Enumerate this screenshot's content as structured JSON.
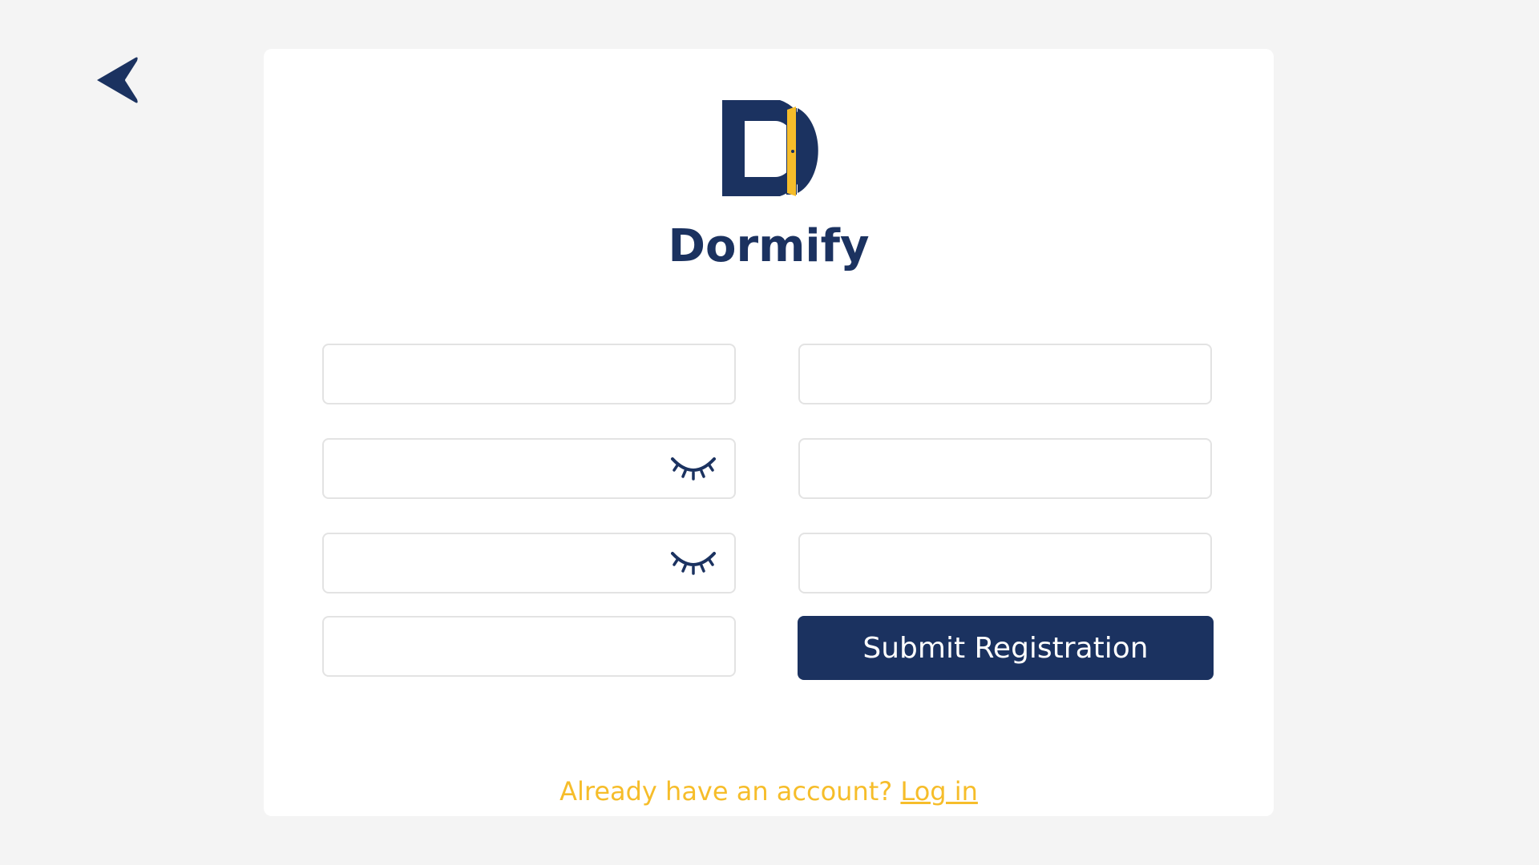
{
  "brand": {
    "name": "Dormify",
    "colors": {
      "primary": "#1b3260",
      "accent": "#f6bd2a"
    }
  },
  "nav": {
    "back_icon": "back-arrow-icon"
  },
  "form": {
    "fields": [
      {
        "id": "field-1",
        "value": "",
        "placeholder": ""
      },
      {
        "id": "field-2",
        "value": "",
        "placeholder": ""
      },
      {
        "id": "field-3",
        "value": "",
        "placeholder": "",
        "icon": "eye-closed-icon"
      },
      {
        "id": "field-4",
        "value": "",
        "placeholder": ""
      },
      {
        "id": "field-5",
        "value": "",
        "placeholder": "",
        "icon": "eye-closed-icon"
      },
      {
        "id": "field-6",
        "value": "",
        "placeholder": ""
      },
      {
        "id": "field-7",
        "value": "",
        "placeholder": ""
      }
    ],
    "submit_label": "Submit Registration"
  },
  "footer": {
    "prompt": "Already have an account?",
    "login_label": "Log in"
  }
}
